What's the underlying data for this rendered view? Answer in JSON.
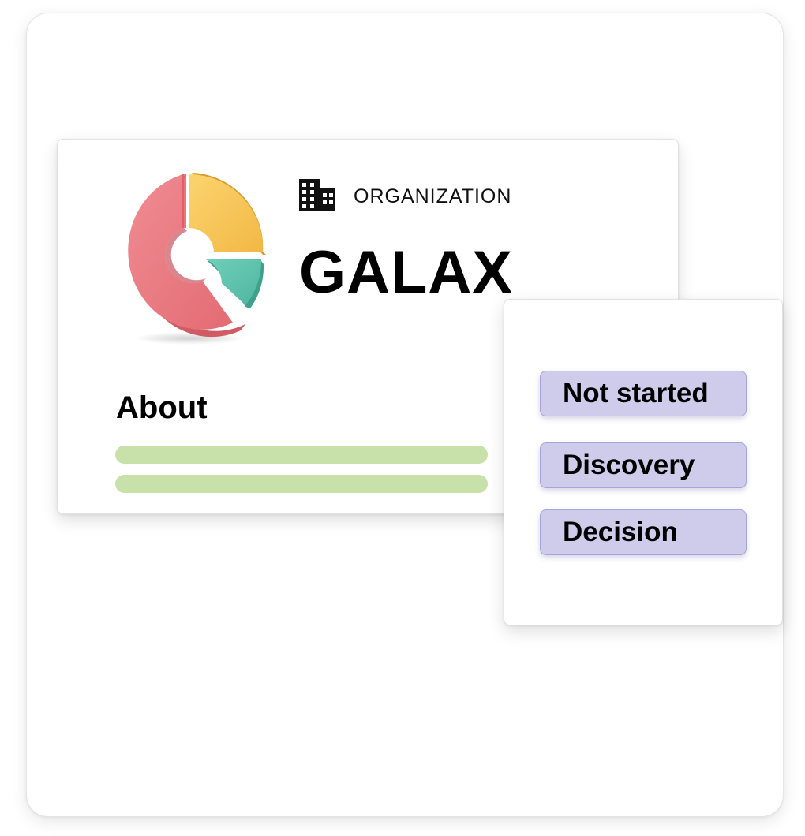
{
  "organization": {
    "type_label": "ORGANIZATION",
    "name": "GALAX",
    "type_icon": "building-icon",
    "logo_icon": "donut-chart-logo",
    "logo_colors": {
      "red": "#ee7a82",
      "yellow": "#f9c95a",
      "teal": "#5ec4ae"
    }
  },
  "about": {
    "heading": "About",
    "placeholder_line_color": "#c8e0aa"
  },
  "statuses": [
    {
      "label": "Not started"
    },
    {
      "label": "Discovery"
    },
    {
      "label": "Decision"
    }
  ],
  "colors": {
    "status_fill": "#cecbeb",
    "status_border": "#a9a4d8"
  }
}
